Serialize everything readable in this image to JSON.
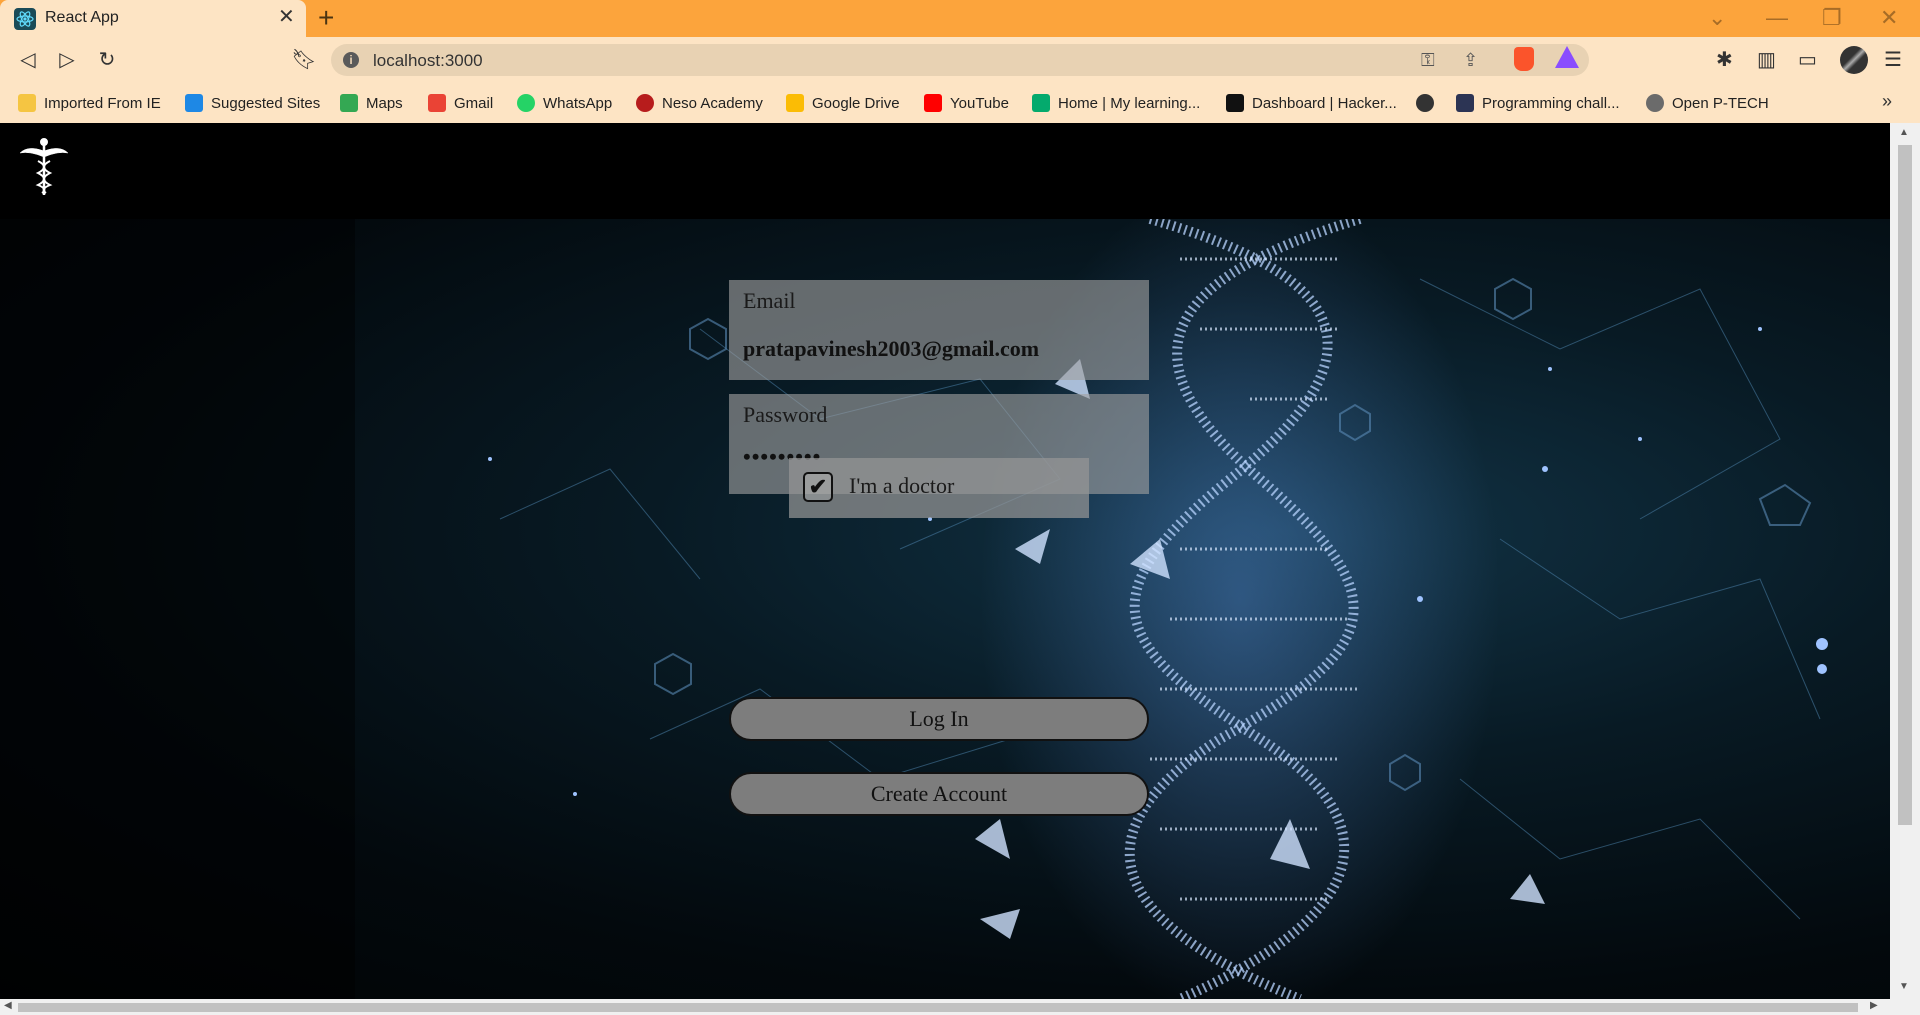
{
  "browser": {
    "tab_title": "React App",
    "url": "localhost:3000",
    "bookmarks": [
      {
        "label": "Imported From IE",
        "icon": "folder-icon",
        "color": "#f5c542"
      },
      {
        "label": "Suggested Sites",
        "icon": "bing-icon",
        "color": "#1e88e5"
      },
      {
        "label": "Maps",
        "icon": "maps-icon",
        "color": "#34a853"
      },
      {
        "label": "Gmail",
        "icon": "gmail-icon",
        "color": "#ea4335"
      },
      {
        "label": "WhatsApp",
        "icon": "whatsapp-icon",
        "color": "#25d366"
      },
      {
        "label": "Neso Academy",
        "icon": "neso-icon",
        "color": "#b71c1c"
      },
      {
        "label": "Google Drive",
        "icon": "drive-icon",
        "color": "#fbbc05"
      },
      {
        "label": "YouTube",
        "icon": "youtube-icon",
        "color": "#ff0000"
      },
      {
        "label": "Home | My learning...",
        "icon": "w3-icon",
        "color": "#04aa6d"
      },
      {
        "label": "Dashboard | Hacker...",
        "icon": "hackerrank-icon",
        "color": "#111111"
      },
      {
        "label": "",
        "icon": "globe-icon",
        "color": "#333333"
      },
      {
        "label": "Programming chall...",
        "icon": "hackerearth-icon",
        "color": "#2c3454"
      },
      {
        "label": "Open P-TECH",
        "icon": "ptech-icon",
        "color": "#6b6b6b"
      }
    ]
  },
  "login": {
    "email_label": "Email",
    "email_value": "pratapavinesh2003@gmail.com",
    "password_label": "Password",
    "password_value": "•••••••••",
    "doctor_checked": true,
    "doctor_label": "I'm a doctor",
    "login_button": "Log In",
    "create_account_button": "Create Account"
  },
  "colors": {
    "chrome_accent": "#fca43c",
    "chrome_bg": "#fde4c4",
    "field_bg": "#a0a0a0",
    "button_bg": "#7d7d7d"
  }
}
